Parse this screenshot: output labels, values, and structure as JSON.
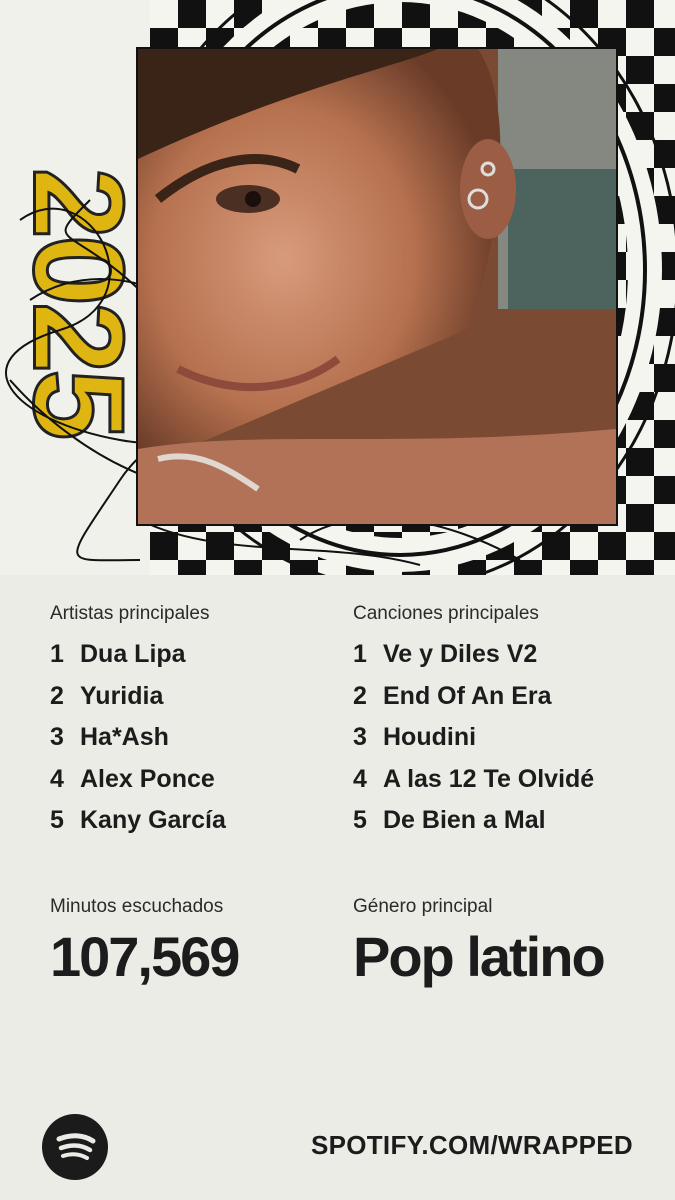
{
  "hero": {
    "year": "2025",
    "year_color": "#dfb512",
    "photo_description_icon": "portrait-photo"
  },
  "top_artists": {
    "title": "Artistas principales",
    "items": [
      {
        "rank": "1",
        "name": "Dua Lipa"
      },
      {
        "rank": "2",
        "name": "Yuridia"
      },
      {
        "rank": "3",
        "name": "Ha*Ash"
      },
      {
        "rank": "4",
        "name": "Alex Ponce"
      },
      {
        "rank": "5",
        "name": "Kany García"
      }
    ]
  },
  "top_songs": {
    "title": "Canciones principales",
    "items": [
      {
        "rank": "1",
        "name": "Ve y Diles V2"
      },
      {
        "rank": "2",
        "name": "End Of An Era"
      },
      {
        "rank": "3",
        "name": "Houdini"
      },
      {
        "rank": "4",
        "name": "A las 12 Te Olvidé"
      },
      {
        "rank": "5",
        "name": "De Bien a Mal"
      }
    ]
  },
  "minutes": {
    "label": "Minutos escuchados",
    "value": "107,569"
  },
  "genre": {
    "label": "Género principal",
    "value": "Pop latino"
  },
  "footer": {
    "url": "SPOTIFY.COM/WRAPPED",
    "logo_icon": "spotify-logo-icon"
  }
}
